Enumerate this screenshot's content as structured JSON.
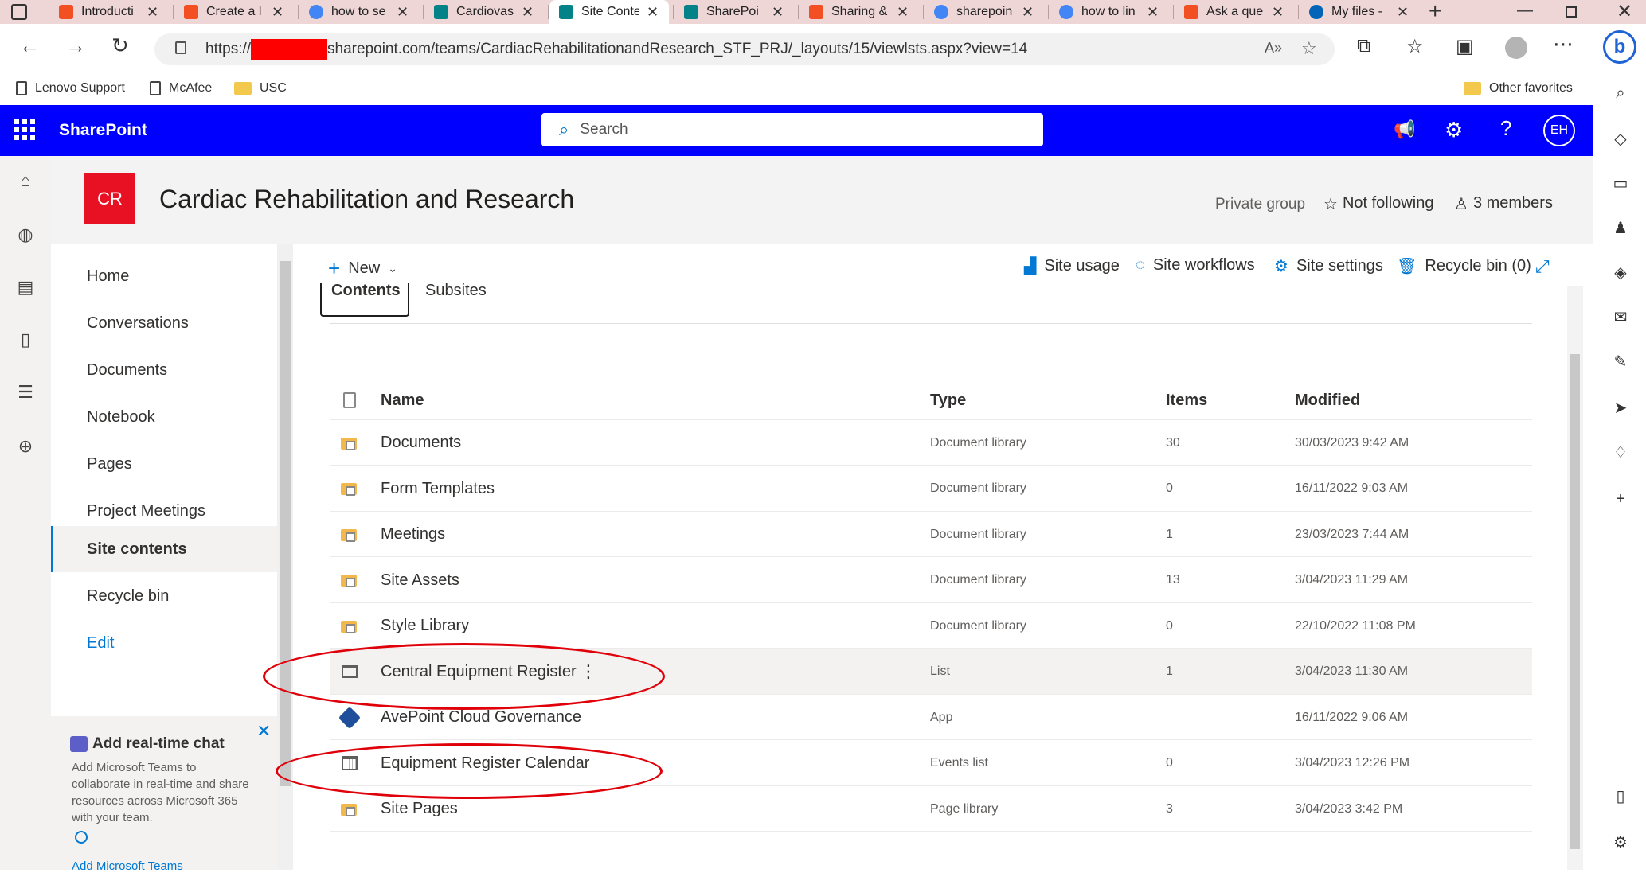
{
  "browser": {
    "tabs": [
      {
        "label": "Introducti",
        "icon": "windows-icon"
      },
      {
        "label": "Create a l",
        "icon": "windows-icon"
      },
      {
        "label": "how to se",
        "icon": "google-icon"
      },
      {
        "label": "Cardiovas",
        "icon": "sharepoint-icon"
      },
      {
        "label": "Site Conte",
        "icon": "sharepoint-icon"
      },
      {
        "label": "SharePoi",
        "icon": "sharepoint-icon"
      },
      {
        "label": "Sharing &",
        "icon": "windows-icon"
      },
      {
        "label": "sharepoin",
        "icon": "google-icon"
      },
      {
        "label": "how to lin",
        "icon": "google-icon"
      },
      {
        "label": "Ask a que",
        "icon": "windows-icon"
      },
      {
        "label": "My files -",
        "icon": "onedrive-icon"
      }
    ],
    "active_tab": 4,
    "url_prefix": "https://",
    "url_rest": "sharepoint.com/teams/CardiacRehabilitationandResearch_STF_PRJ/_layouts/15/viewlsts.aspx?view=14",
    "favorites": [
      "Lenovo Support",
      "McAfee",
      "USC"
    ],
    "other_favorites": "Other favorites"
  },
  "suite": {
    "app_name": "SharePoint",
    "search_placeholder": "Search",
    "avatar_initials": "EH"
  },
  "site": {
    "logo_initials": "CR",
    "title": "Cardiac Rehabilitation and Research",
    "privacy": "Private group",
    "follow": "Not following",
    "members": "3 members"
  },
  "nav": {
    "items": [
      "Home",
      "Conversations",
      "Documents",
      "Notebook",
      "Pages",
      "Project Meetings",
      "Site contents",
      "Recycle bin"
    ],
    "selected": "Site contents",
    "edit": "Edit"
  },
  "teams_promo": {
    "title": "Add real-time chat",
    "body": "Add Microsoft Teams to collaborate in real-time and share resources across Microsoft 365 with your team.",
    "link": "Add Microsoft Teams"
  },
  "commands": {
    "new": "New",
    "site_usage": "Site usage",
    "site_workflows": "Site workflows",
    "site_settings": "Site settings",
    "recycle_bin": "Recycle bin (0)"
  },
  "tabs": {
    "contents": "Contents",
    "subsites": "Subsites"
  },
  "list": {
    "headers": {
      "name": "Name",
      "type": "Type",
      "items": "Items",
      "modified": "Modified"
    },
    "rows": [
      {
        "name": "Documents",
        "type": "Document library",
        "items": "30",
        "modified": "30/03/2023 9:42 AM",
        "icon": "library-icon"
      },
      {
        "name": "Form Templates",
        "type": "Document library",
        "items": "0",
        "modified": "16/11/2022 9:03 AM",
        "icon": "library-icon"
      },
      {
        "name": "Meetings",
        "type": "Document library",
        "items": "1",
        "modified": "23/03/2023 7:44 AM",
        "icon": "library-icon"
      },
      {
        "name": "Site Assets",
        "type": "Document library",
        "items": "13",
        "modified": "3/04/2023 11:29 AM",
        "icon": "library-icon"
      },
      {
        "name": "Style Library",
        "type": "Document library",
        "items": "0",
        "modified": "22/10/2022 11:08 PM",
        "icon": "library-icon"
      },
      {
        "name": "Central Equipment Register",
        "type": "List",
        "items": "1",
        "modified": "3/04/2023 11:30 AM",
        "icon": "list-icon"
      },
      {
        "name": "AvePoint Cloud Governance",
        "type": "App",
        "items": "",
        "modified": "16/11/2022 9:06 AM",
        "icon": "app-icon"
      },
      {
        "name": "Equipment Register Calendar",
        "type": "Events list",
        "items": "0",
        "modified": "3/04/2023 12:26 PM",
        "icon": "calendar-icon"
      },
      {
        "name": "Site Pages",
        "type": "Page library",
        "items": "3",
        "modified": "3/04/2023 3:42 PM",
        "icon": "library-icon"
      }
    ]
  },
  "colors": {
    "suite_blue": "#0000ff",
    "logo_red": "#e81123",
    "annotation_red": "#e0000a",
    "link_blue": "#0078d4"
  }
}
